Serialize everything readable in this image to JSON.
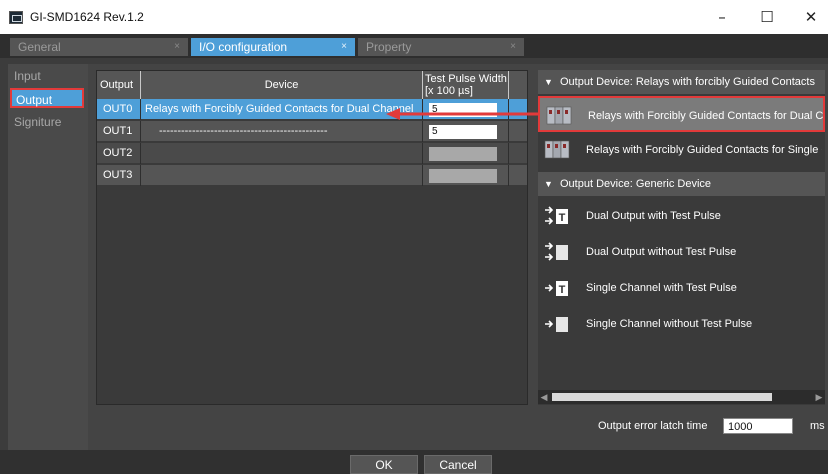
{
  "window": {
    "title": "GI-SMD1624 Rev.1.2",
    "minimize": "–",
    "maximize": "☐",
    "close": "✕"
  },
  "tabs": [
    {
      "label": "General",
      "close": "×",
      "active": false
    },
    {
      "label": "I/O configuration",
      "close": "×",
      "active": true
    },
    {
      "label": "Property",
      "close": "×",
      "active": false
    }
  ],
  "sidebar": {
    "items": [
      {
        "label": "Input",
        "selected": false
      },
      {
        "label": "Output",
        "selected": true
      },
      {
        "label": "Signiture",
        "selected": false
      }
    ]
  },
  "table": {
    "headers": {
      "output": "Output",
      "device": "Device",
      "pulse_line1": "Test Pulse Width",
      "pulse_line2": "[x 100 µs]"
    },
    "rows": [
      {
        "output": "OUT0",
        "device": "Relays with Forcibly Guided Contacts for Dual Channel",
        "pulse": "5",
        "selected": true
      },
      {
        "output": "OUT1",
        "device": "----------------------------------------------",
        "pulse": "5",
        "selected": false
      },
      {
        "output": "OUT2",
        "device": "",
        "pulse": "",
        "selected": false
      },
      {
        "output": "OUT3",
        "device": "",
        "pulse": "",
        "selected": false
      }
    ]
  },
  "palette": {
    "groups": [
      {
        "header": "Output Device: Relays with forcibly Guided Contacts",
        "items": [
          {
            "label": "Relays with Forcibly Guided Contacts for Dual Channel",
            "icon": "relay-icon",
            "selected": true
          },
          {
            "label": "Relays with Forcibly Guided Contacts for Single Channel",
            "icon": "relay-icon",
            "selected": false
          }
        ]
      },
      {
        "header": "Output Device: Generic Device",
        "items": [
          {
            "label": "Dual Output with Test Pulse",
            "icon": "dual-output-test-pulse-icon"
          },
          {
            "label": "Dual Output without Test Pulse",
            "icon": "dual-output-icon"
          },
          {
            "label": "Single Channel with Test Pulse",
            "icon": "single-channel-test-pulse-icon"
          },
          {
            "label": "Single Channel without Test Pulse",
            "icon": "single-channel-icon"
          }
        ]
      }
    ]
  },
  "latch": {
    "label": "Output error latch time",
    "value": "1000",
    "unit": "ms"
  },
  "buttons": {
    "ok": "OK",
    "cancel": "Cancel"
  },
  "colors": {
    "accent": "#4e9fd8",
    "highlight": "#e23a3a"
  }
}
